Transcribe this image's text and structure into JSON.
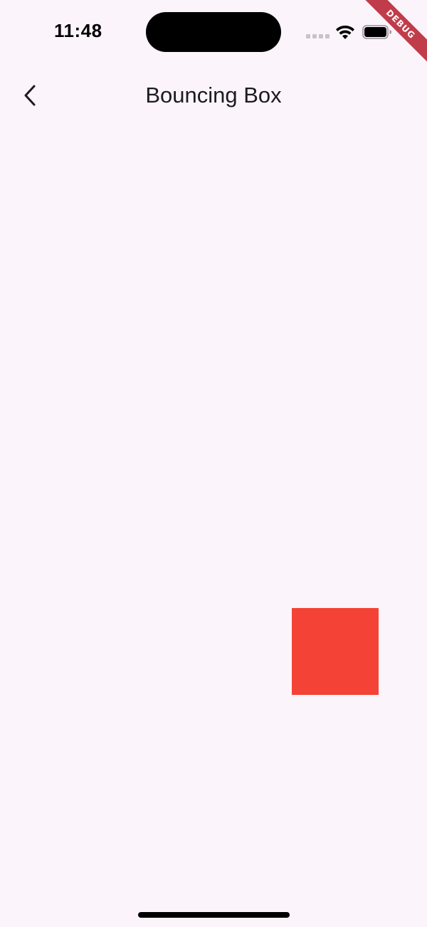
{
  "status_bar": {
    "time": "11:48",
    "icons": [
      "cellular-signal-icon",
      "wifi-icon",
      "battery-icon"
    ]
  },
  "debug_banner": {
    "label": "DEBUG",
    "color": "#b71c2c"
  },
  "app_bar": {
    "title": "Bouncing Box",
    "back_icon": "chevron-left-icon"
  },
  "animation": {
    "box_color": "#f44336"
  },
  "colors": {
    "background": "#fcf4fb",
    "title_text": "#1d1b20"
  }
}
